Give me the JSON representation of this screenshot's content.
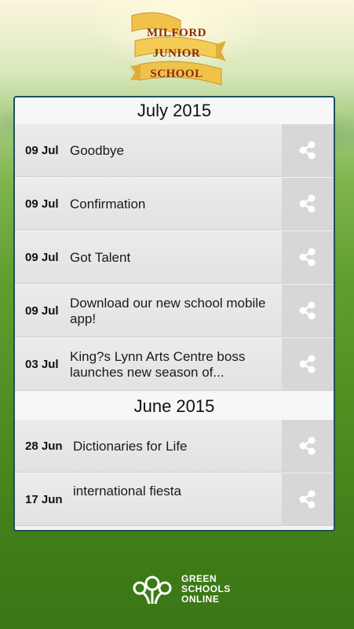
{
  "school": {
    "line1": "MILFORD",
    "line2": "JUNIOR",
    "line3": "SCHOOL"
  },
  "months": [
    {
      "label": "July 2015",
      "items": [
        {
          "date": "09 Jul",
          "title": "Goodbye"
        },
        {
          "date": "09 Jul",
          "title": "Confirmation"
        },
        {
          "date": "09 Jul",
          "title": "Got Talent"
        },
        {
          "date": "09 Jul",
          "title": "Download our new school mobile app!"
        },
        {
          "date": "03 Jul",
          "title": "King?s Lynn Arts Centre boss launches new season of..."
        }
      ]
    },
    {
      "label": "June 2015",
      "items": [
        {
          "date": "28 Jun",
          "title": "Dictionaries for Life"
        },
        {
          "date": "17 Jun",
          "title": "international fiesta"
        }
      ]
    }
  ],
  "footer": {
    "line1": "GREEN",
    "line2": "SCHOOLS",
    "line3": "ONLINE"
  },
  "icons": {
    "share": "share-icon",
    "footer_logo": "tree-logo-icon"
  },
  "colors": {
    "panel_border": "#1f4f5e",
    "logo_text": "#8a2a0e",
    "banner": "#f2c84b"
  }
}
